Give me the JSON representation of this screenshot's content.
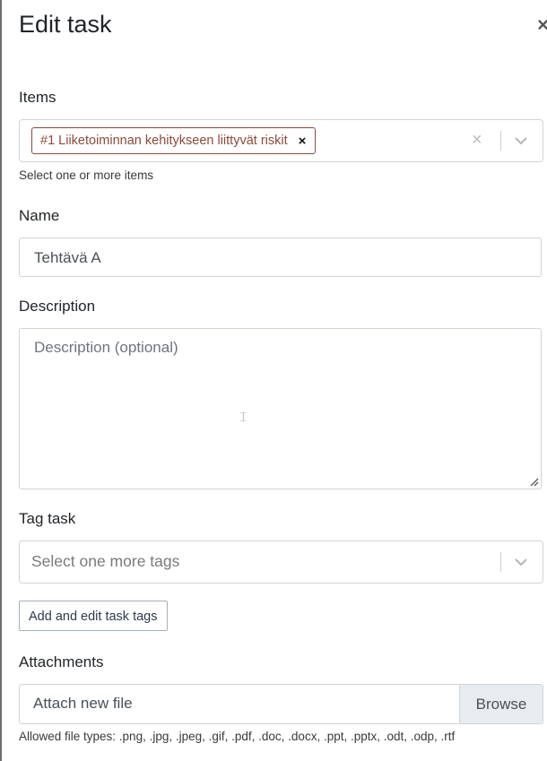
{
  "dialog": {
    "title": "Edit task",
    "close_label": "×"
  },
  "items": {
    "label": "Items",
    "selected": [
      "#1 Liiketoiminnan kehitykseen liittyvät riskit"
    ],
    "chip_remove": "×",
    "clear_icon": "×",
    "help": "Select one or more items"
  },
  "name": {
    "label": "Name",
    "value": "Tehtävä A"
  },
  "description": {
    "label": "Description",
    "placeholder": "Description (optional)"
  },
  "tags": {
    "label": "Tag task",
    "placeholder": "Select one more tags",
    "button": "Add and edit task tags"
  },
  "attachments": {
    "label": "Attachments",
    "file_placeholder": "Attach new file",
    "browse": "Browse",
    "help": "Allowed file types: .png, .jpg, .jpeg, .gif, .pdf, .doc, .docx, .ppt, .pptx, .odt, .odp, .rtf"
  },
  "colors": {
    "chip": "#8b4a3a",
    "border": "#cfd4da",
    "browse_bg": "#e9ecef"
  }
}
